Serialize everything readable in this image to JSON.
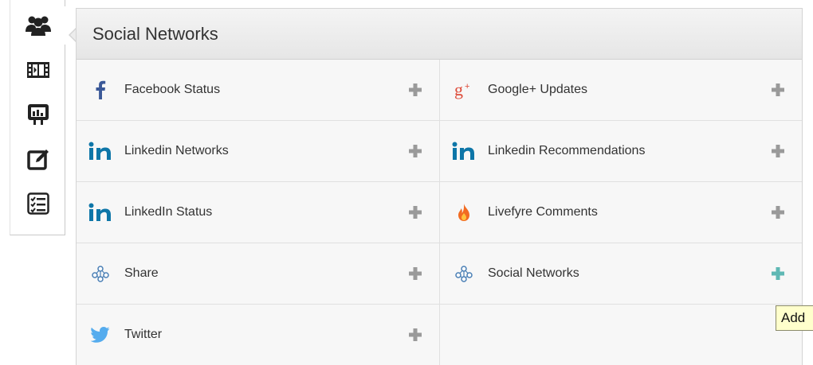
{
  "toolbar": {
    "items": [
      {
        "name": "users-icon"
      },
      {
        "name": "film-icon"
      },
      {
        "name": "presentation-icon"
      },
      {
        "name": "edit-icon"
      },
      {
        "name": "checklist-icon"
      }
    ]
  },
  "panel": {
    "title": "Social Networks",
    "items": [
      {
        "label": "Facebook Status",
        "icon": "facebook-icon"
      },
      {
        "label": "Google+ Updates",
        "icon": "google-plus-icon"
      },
      {
        "label": "Linkedin Networks",
        "icon": "linkedin-icon"
      },
      {
        "label": "Linkedin Recommendations",
        "icon": "linkedin-icon"
      },
      {
        "label": "LinkedIn Status",
        "icon": "linkedin-icon"
      },
      {
        "label": "Livefyre Comments",
        "icon": "livefyre-flame-icon"
      },
      {
        "label": "Share",
        "icon": "share-network-icon"
      },
      {
        "label": "Social Networks",
        "icon": "share-network-icon"
      },
      {
        "label": "Twitter",
        "icon": "twitter-bird-icon"
      }
    ]
  },
  "tooltip": {
    "text": "Add"
  },
  "colors": {
    "facebook": "#3b5998",
    "google": "#dd4b39",
    "linkedin": "#0e76a8",
    "twitter": "#55acee",
    "add_default": "#9a9a9a",
    "add_hover": "#5fb8b4"
  }
}
